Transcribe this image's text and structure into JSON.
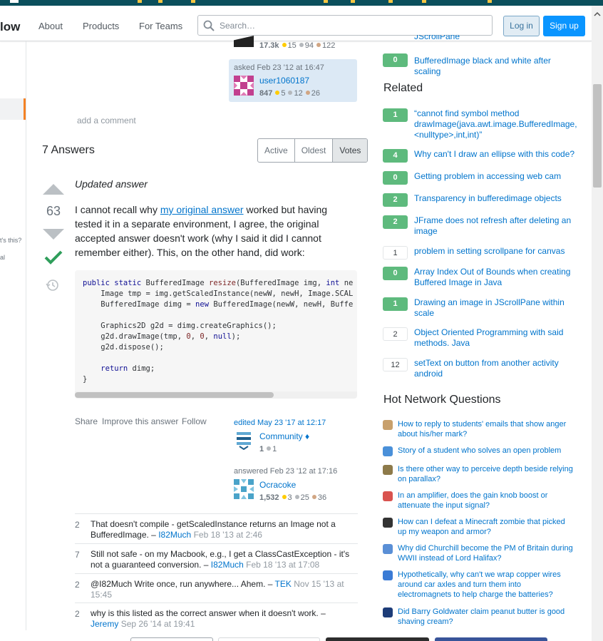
{
  "header": {
    "logo": "low",
    "nav": [
      "About",
      "Products",
      "For Teams"
    ],
    "search_placeholder": "Search…",
    "login": "Log in",
    "signup": "Sign up"
  },
  "leftnav": {
    "snippet1": "t's this?",
    "snippet2": "al"
  },
  "question": {
    "editor_rep": "17.3k",
    "editor_gold": "15",
    "editor_silver": "94",
    "editor_bronze": "122",
    "asked": "asked Feb 23 '12 at 16:47",
    "asker": "user1060187",
    "asker_rep": "847",
    "asker_gold": "5",
    "asker_silver": "12",
    "asker_bronze": "26",
    "add_comment": "add a comment"
  },
  "answers_header": {
    "count_label": "7 Answers",
    "sort_tabs": [
      "Active",
      "Oldest",
      "Votes"
    ]
  },
  "answer": {
    "votes": "63",
    "heading": "Updated answer",
    "body_before_link": "I cannot recall why ",
    "link_text": "my original answer",
    "body_after_link": " worked but having tested it in a separate environment, I agree, the original accepted answer doesn't work (why I said it did I cannot remember either). This, on the other hand, did work:",
    "menu": [
      "Share",
      "Improve this answer",
      "Follow"
    ],
    "edited": "edited May 23 '17 at 12:17",
    "editor": "Community ♦",
    "editor_rep": "1",
    "editor_silver": "1",
    "answered": "answered Feb 23 '12 at 17:16",
    "answerer": "Ocracoke",
    "answerer_rep": "1,532",
    "answerer_gold": "3",
    "answerer_silver": "25",
    "answerer_bronze": "36"
  },
  "code_lines": [
    "public static BufferedImage resize(BufferedImage img, int ne",
    "    Image tmp = img.getScaledInstance(newW, newH, Image.SCAL",
    "    BufferedImage dimg = new BufferedImage(newW, newH, Buffe",
    "",
    "    Graphics2D g2d = dimg.createGraphics();",
    "    g2d.drawImage(tmp, 0, 0, null);",
    "    g2d.dispose();",
    "",
    "    return dimg;",
    "}"
  ],
  "comments": [
    {
      "score": "2",
      "text": "That doesn't compile - getScaledInstance returns an Image not a BufferedImage. –",
      "user": "I82Much",
      "date": "Feb 18 '13 at 2:46"
    },
    {
      "score": "7",
      "text": "Still not safe - on my Macbook, e.g., I get a ClassCastException - it's not a guaranteed conversion. –",
      "user": "I82Much",
      "date": "Feb 18 '13 at 17:08"
    },
    {
      "score": "2",
      "text": "@I82Much Write once, run anywhere... Ahem. –",
      "user": "TEK",
      "date": "Nov 15 '13 at 15:45"
    },
    {
      "score": "2",
      "text": "why is this listed as the correct answer when it doesn't work. –",
      "user": "Jeremy",
      "date": "Sep 26 '14 at 19:41"
    }
  ],
  "sidebar": {
    "top_partial": "JScrollPane",
    "top_linked": {
      "score": "0",
      "title": "BufferedImage black and white after scaling"
    },
    "related_title": "Related",
    "related": [
      {
        "score": "1",
        "accepted": true,
        "title": "“cannot find symbol method drawImage(java.awt.image.BufferedImage,<nulltype>,int,int)”"
      },
      {
        "score": "4",
        "accepted": true,
        "title": "Why can't I draw an ellipse with this code?"
      },
      {
        "score": "0",
        "accepted": true,
        "title": "Getting problem in accessing web cam"
      },
      {
        "score": "2",
        "accepted": true,
        "title": "Transparency in bufferedimage objects"
      },
      {
        "score": "2",
        "accepted": true,
        "title": "JFrame does not refresh after deleting an image"
      },
      {
        "score": "1",
        "accepted": false,
        "title": "problem in setting scrollpane for canvas"
      },
      {
        "score": "0",
        "accepted": true,
        "title": "Array Index Out of Bounds when creating Buffered Image in Java"
      },
      {
        "score": "1",
        "accepted": true,
        "title": "Drawing an image in JScrollPane within scale"
      },
      {
        "score": "2",
        "accepted": false,
        "title": "Object Oriented Programming with said methods. Java"
      },
      {
        "score": "12",
        "accepted": false,
        "title": "setText on button from another activity android"
      }
    ],
    "hnq_title": "Hot Network Questions",
    "hnq": [
      {
        "site": "academia",
        "color": "#c8a06c",
        "title": "How to reply to students' emails that show anger about his/her mark?"
      },
      {
        "site": "hsm",
        "color": "#4a90d9",
        "title": "Story of a student who solves an open problem"
      },
      {
        "site": "astronomy",
        "color": "#8d7a4a",
        "title": "Is there other way to perceive depth beside relying on parallax?"
      },
      {
        "site": "electronics",
        "color": "#d9534f",
        "title": "In an amplifier, does the gain knob boost or attenuate the input signal?"
      },
      {
        "site": "gaming",
        "color": "#333333",
        "title": "How can I defeat a Minecraft zombie that picked up my weapon and armor?"
      },
      {
        "site": "history",
        "color": "#5a8fd6",
        "title": "Why did Churchill become the PM of Britain during WWII instead of Lord Halifax?"
      },
      {
        "site": "physics",
        "color": "#3a7bd5",
        "title": "Hypothetically, why can't we wrap copper wires around car axles and turn them into electromagnets to help charge the batteries?"
      },
      {
        "site": "skeptics",
        "color": "#1d3c78",
        "title": "Did Barry Goldwater claim peanut butter is good shaving cream?"
      }
    ]
  }
}
